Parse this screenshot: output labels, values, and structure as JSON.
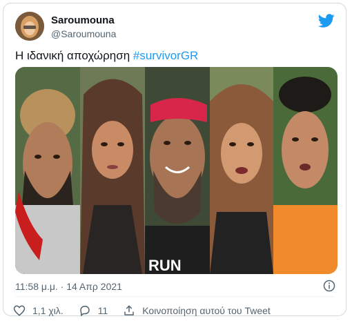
{
  "user": {
    "name": "Saroumouna",
    "handle": "@Saroumouna"
  },
  "tweet": {
    "text_prefix": "Η ιδανική αποχώρηση ",
    "hashtag": "#survivorGR"
  },
  "media": {
    "shirt_text": "RUN"
  },
  "meta": {
    "timestamp": "11:58 μ.μ. · 14 Απρ 2021"
  },
  "actions": {
    "likes": "1,1 χιλ.",
    "replies": "11",
    "share_label": "Κοινοποίηση αυτού του Tweet"
  },
  "colors": {
    "accent": "#1d9bf0",
    "like": "#536471"
  },
  "icons": [
    "twitter-bird-icon",
    "info-icon",
    "heart-icon",
    "reply-icon",
    "share-icon"
  ]
}
